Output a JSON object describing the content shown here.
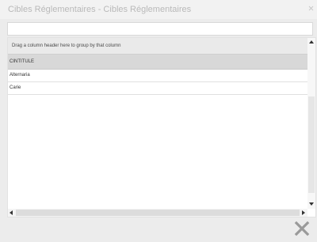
{
  "window": {
    "title": "Cibles Réglementaires - Cibles Réglementaires",
    "close_icon": "close-icon"
  },
  "search": {
    "value": "",
    "placeholder": ""
  },
  "grid": {
    "group_panel_text": "Drag a column header here to group by that column",
    "columns": [
      "CINTITULE"
    ],
    "rows": [
      {
        "cintitule": "Alternaria"
      },
      {
        "cintitule": "Carie"
      }
    ]
  },
  "footer": {
    "close_icon": "close-x-icon"
  },
  "colors": {
    "title_text": "#b9b9b9",
    "header_bg": "#d8d8d8",
    "close_x": "#9a9a9a"
  }
}
